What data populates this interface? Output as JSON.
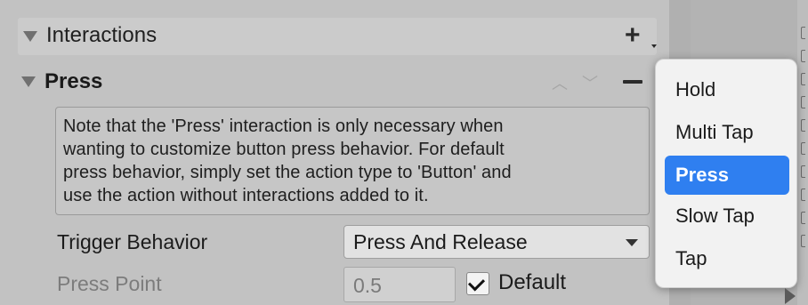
{
  "interactions_header": {
    "title": "Interactions",
    "add_icon": "plus-icon"
  },
  "press_section": {
    "title": "Press",
    "up_icon": "chevron-up-icon",
    "down_icon": "chevron-down-icon",
    "remove_icon": "minus-icon",
    "help_lines": [
      "Note that the 'Press' interaction is only necessary when",
      "wanting to customize button press behavior. For default",
      "press behavior, simply set the action type to 'Button' and",
      "use the action without interactions added to it."
    ],
    "trigger_behavior": {
      "label": "Trigger Behavior",
      "value": "Press And Release"
    },
    "press_point": {
      "label": "Press Point",
      "value": "0.5",
      "default_label": "Default",
      "default_checked": true
    }
  },
  "popup_menu": {
    "items": [
      "Hold",
      "Multi Tap",
      "Press",
      "Slow Tap",
      "Tap"
    ],
    "selected": "Press"
  },
  "colors": {
    "selection": "#2f7ff0",
    "panel": "#c2c2c2"
  }
}
